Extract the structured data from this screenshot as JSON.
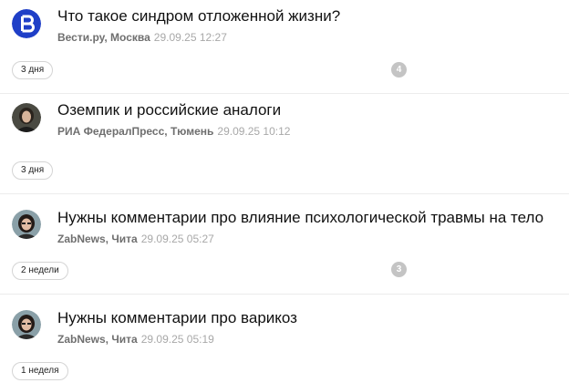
{
  "feed": {
    "items": [
      {
        "title": "Что такое синдром отложенной жизни?",
        "source": "Вести.ру, Москва",
        "time": "29.09.25 12:27",
        "age": "3 дня",
        "comment_count": "4",
        "avatar_icon": "vesti-logo-icon"
      },
      {
        "title": "Оземпик и российские аналоги",
        "source": "РИА ФедералПресс, Тюмень",
        "time": "29.09.25 10:12",
        "age": "3 дня",
        "comment_count": "",
        "avatar_icon": "user-photo-avatar"
      },
      {
        "title": "Нужны комментарии про влияние психологической травмы на тело",
        "source": "ZabNews, Чита",
        "time": "29.09.25 05:27",
        "age": "2 недели",
        "comment_count": "3",
        "avatar_icon": "user-photo-avatar"
      },
      {
        "title": "Нужны комментарии про варикоз",
        "source": "ZabNews, Чита",
        "time": "29.09.25 05:19",
        "age": "1 неделя",
        "comment_count": "",
        "avatar_icon": "user-photo-avatar"
      }
    ]
  },
  "colors": {
    "vesti_blue": "#1f3fc7",
    "badge_border": "#d4d4d4",
    "count_bg": "#c4c4c4",
    "source_text": "#6f6f6f",
    "time_text": "#a8a8a8"
  }
}
